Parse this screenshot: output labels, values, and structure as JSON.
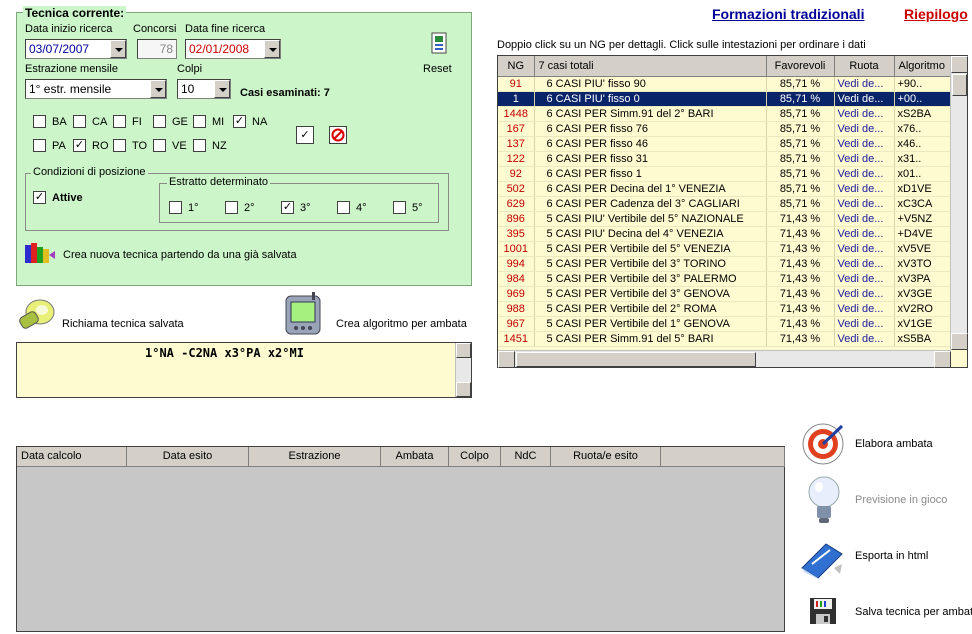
{
  "top_links": {
    "formazioni": "Formazioni tradizionali",
    "riepilogo": "Riepilogo"
  },
  "grid_hint": "Doppio click su un NG per dettagli. Click sulle intestazioni per ordinare i dati",
  "tecnica": {
    "title": "Tecnica corrente:",
    "data_inizio_label": "Data inizio ricerca",
    "data_inizio_value": "03/07/2007",
    "concorsi_label": "Concorsi",
    "concorsi_value": "78",
    "data_fine_label": "Data fine ricerca",
    "data_fine_value": "02/01/2008",
    "reset_label": "Reset",
    "estrazione_label": "Estrazione mensile",
    "estrazione_value": "1° estr. mensile",
    "colpi_label": "Colpi",
    "colpi_value": "10",
    "casi_esaminati": "Casi esaminati: 7",
    "ruote": [
      {
        "name": "BA",
        "checked": false
      },
      {
        "name": "CA",
        "checked": false
      },
      {
        "name": "FI",
        "checked": false
      },
      {
        "name": "GE",
        "checked": false
      },
      {
        "name": "MI",
        "checked": false
      },
      {
        "name": "NA",
        "checked": true
      },
      {
        "name": "PA",
        "checked": false
      },
      {
        "name": "RO",
        "checked": true
      },
      {
        "name": "TO",
        "checked": false
      },
      {
        "name": "VE",
        "checked": false
      },
      {
        "name": "NZ",
        "checked": false
      }
    ],
    "condizioni_title": "Condizioni di posizione",
    "attive_label": "Attive",
    "attive_checked": true,
    "estratto_title": "Estratto determinato",
    "estratti": [
      {
        "name": "1°",
        "checked": false
      },
      {
        "name": "2°",
        "checked": false
      },
      {
        "name": "3°",
        "checked": true
      },
      {
        "name": "4°",
        "checked": false
      },
      {
        "name": "5°",
        "checked": false
      }
    ],
    "crea_nuova_label": "Crea nuova tecnica partendo da una già salvata"
  },
  "richiama_label": "Richiama tecnica salvata",
  "crea_algoritmo_label": "Crea algoritmo per ambata",
  "formula_text": "1°NA -C2NA x3°PA x2°MI",
  "grid": {
    "columns": [
      "NG",
      "7 casi totali",
      "Favorevoli",
      "Ruota",
      "Algoritmo"
    ],
    "rows": [
      {
        "ng": "91",
        "casi": "6 CASI PIU' fisso 90",
        "fav": "85,71 %",
        "ruota": "Vedi de...",
        "alg": "+90.."
      },
      {
        "ng": "1",
        "casi": "6 CASI PIU' fisso 0",
        "fav": "85,71 %",
        "ruota": "Vedi de...",
        "alg": "+00..",
        "selected": true
      },
      {
        "ng": "1448",
        "casi": "6 CASI PER Simm.91 del 2° BARI",
        "fav": "85,71 %",
        "ruota": "Vedi de...",
        "alg": "xS2BA"
      },
      {
        "ng": "167",
        "casi": "6 CASI PER fisso 76",
        "fav": "85,71 %",
        "ruota": "Vedi de...",
        "alg": "x76.."
      },
      {
        "ng": "137",
        "casi": "6 CASI PER fisso 46",
        "fav": "85,71 %",
        "ruota": "Vedi de...",
        "alg": "x46.."
      },
      {
        "ng": "122",
        "casi": "6 CASI PER fisso 31",
        "fav": "85,71 %",
        "ruota": "Vedi de...",
        "alg": "x31.."
      },
      {
        "ng": "92",
        "casi": "6 CASI PER fisso 1",
        "fav": "85,71 %",
        "ruota": "Vedi de...",
        "alg": "x01.."
      },
      {
        "ng": "502",
        "casi": "6 CASI PER Decina del 1° VENEZIA",
        "fav": "85,71 %",
        "ruota": "Vedi de...",
        "alg": "xD1VE"
      },
      {
        "ng": "629",
        "casi": "6 CASI PER Cadenza del 3° CAGLIARI",
        "fav": "85,71 %",
        "ruota": "Vedi de...",
        "alg": "xC3CA"
      },
      {
        "ng": "896",
        "casi": "5 CASI PIU' Vertibile del 5° NAZIONALE",
        "fav": "71,43 %",
        "ruota": "Vedi de...",
        "alg": "+V5NZ"
      },
      {
        "ng": "395",
        "casi": "5 CASI PIU' Decina del 4° VENEZIA",
        "fav": "71,43 %",
        "ruota": "Vedi de...",
        "alg": "+D4VE"
      },
      {
        "ng": "1001",
        "casi": "5 CASI PER Vertibile del 5° VENEZIA",
        "fav": "71,43 %",
        "ruota": "Vedi de...",
        "alg": "xV5VE"
      },
      {
        "ng": "994",
        "casi": "5 CASI PER Vertibile del 3° TORINO",
        "fav": "71,43 %",
        "ruota": "Vedi de...",
        "alg": "xV3TO"
      },
      {
        "ng": "984",
        "casi": "5 CASI PER Vertibile del 3° PALERMO",
        "fav": "71,43 %",
        "ruota": "Vedi de...",
        "alg": "xV3PA"
      },
      {
        "ng": "969",
        "casi": "5 CASI PER Vertibile del 3° GENOVA",
        "fav": "71,43 %",
        "ruota": "Vedi de...",
        "alg": "xV3GE"
      },
      {
        "ng": "988",
        "casi": "5 CASI PER Vertibile del 2° ROMA",
        "fav": "71,43 %",
        "ruota": "Vedi de...",
        "alg": "xV2RO"
      },
      {
        "ng": "967",
        "casi": "5 CASI PER Vertibile del 1° GENOVA",
        "fav": "71,43 %",
        "ruota": "Vedi de...",
        "alg": "xV1GE"
      },
      {
        "ng": "1451",
        "casi": "5 CASI PER Simm.91 del 5° BARI",
        "fav": "71,43 %",
        "ruota": "Vedi de...",
        "alg": "xS5BA"
      }
    ]
  },
  "results": {
    "columns": [
      "Data calcolo",
      "Data esito",
      "Estrazione",
      "Ambata",
      "Colpo",
      "NdC",
      "Ruota/e esito"
    ]
  },
  "actions": {
    "elabora": "Elabora ambata",
    "previsione": "Previsione in gioco",
    "esporta": "Esporta in html",
    "salva": "Salva tecnica per ambata"
  },
  "colors": {
    "panel_green": "#ccf5c9",
    "grid_yellow": "#fffbd0",
    "selection": "#0a246a",
    "ng_red": "#c00000",
    "link_blue": "#000099"
  }
}
